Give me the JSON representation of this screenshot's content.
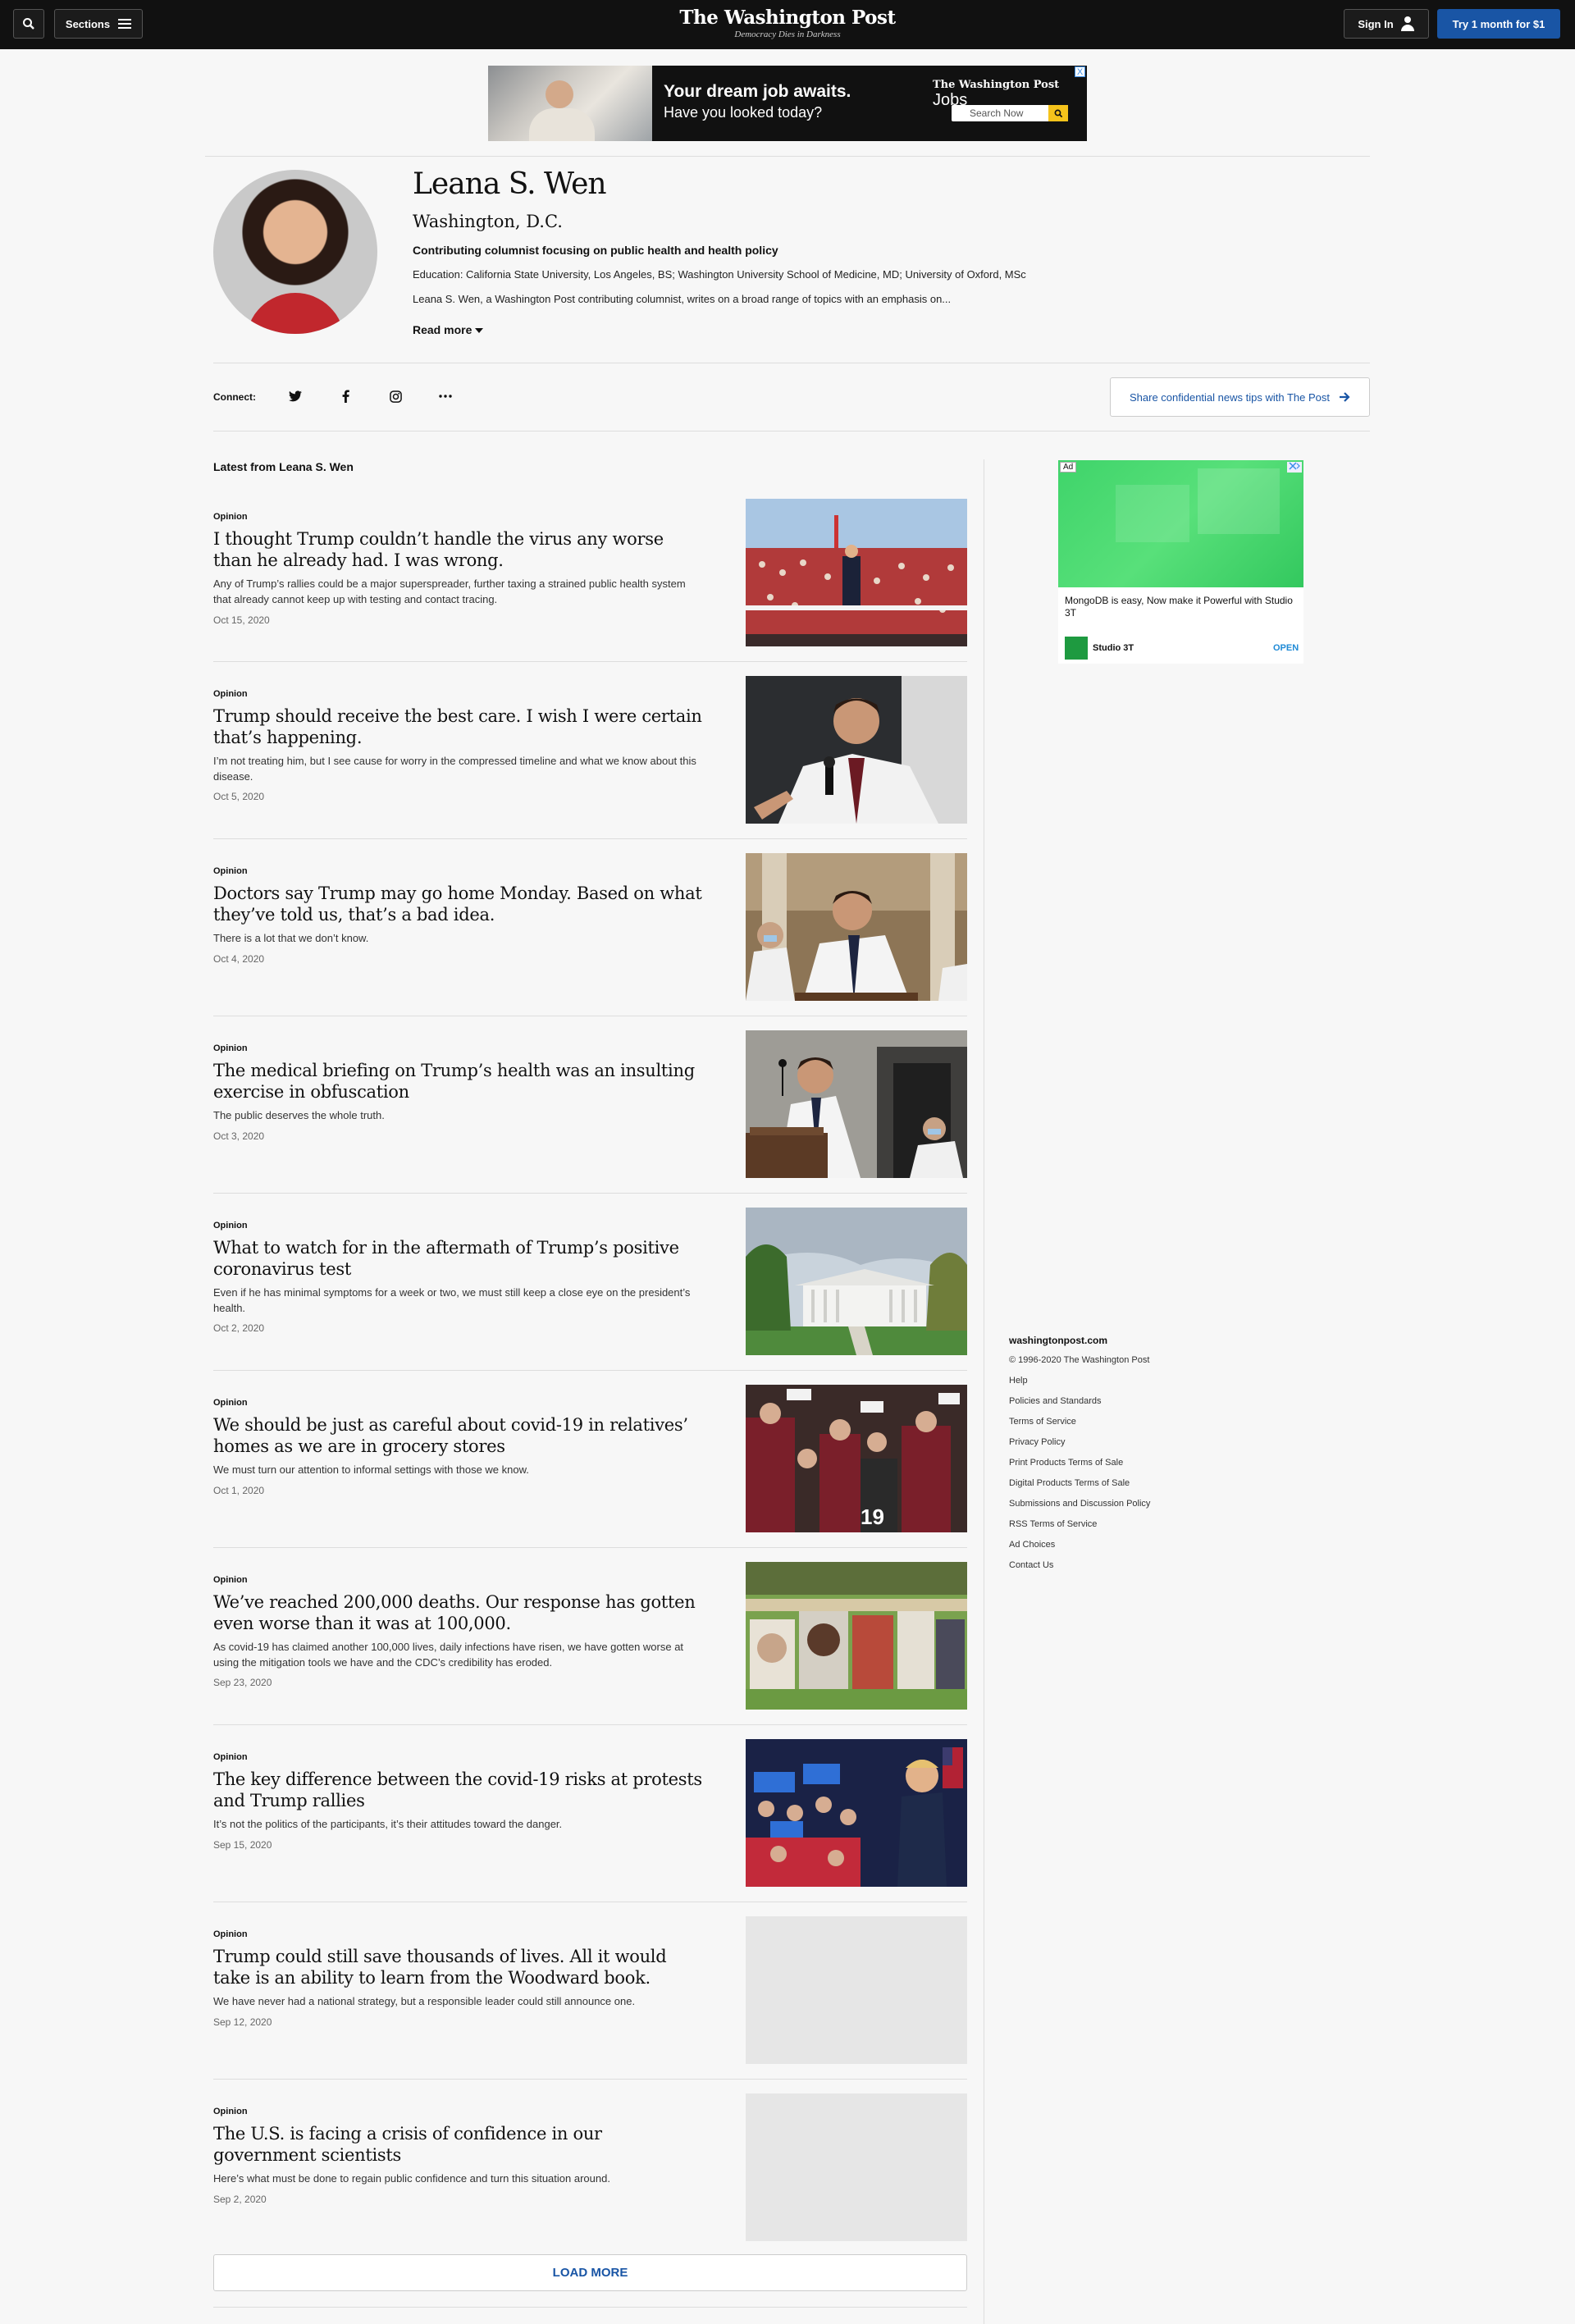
{
  "header": {
    "sections_label": "Sections",
    "logo": "The Washington Post",
    "tagline": "Democracy Dies in Darkness",
    "signin_label": "Sign In",
    "subscribe_label": "Try 1 month for $1"
  },
  "top_ad": {
    "headline": "Your dream job awaits.",
    "subline": "Have you looked today?",
    "brand": "The Washington Post",
    "brand_suffix": "Jobs",
    "search_label": "Search Now",
    "close": "X"
  },
  "author": {
    "name": "Leana S. Wen",
    "location": "Washington, D.C.",
    "role": "Contributing columnist focusing on public health and health policy",
    "education": "Education: California State University, Los Angeles, BS; Washington University School of Medicine, MD; University of Oxford, MSc",
    "bio": "Leana S. Wen, a Washington Post contributing columnist, writes on a broad range of topics with an emphasis on...",
    "read_more": "Read more"
  },
  "connect": {
    "label": "Connect:",
    "tips_label": "Share confidential news tips with The Post"
  },
  "feed": {
    "label": "Latest from Leana S. Wen",
    "load_more": "LOAD MORE",
    "articles": [
      {
        "kicker": "Opinion",
        "headline": "I thought Trump couldn’t handle the virus any worse than he already had. I was wrong.",
        "blurb": "Any of Trump’s rallies could be a major superspreader, further taxing a strained public health system that already cannot keep up with testing and contact tracing.",
        "date": "Oct 15, 2020"
      },
      {
        "kicker": "Opinion",
        "headline": "Trump should receive the best care. I wish I were certain that’s happening.",
        "blurb": "I’m not treating him, but I see cause for worry in the compressed timeline and what we know about this disease.",
        "date": "Oct 5, 2020"
      },
      {
        "kicker": "Opinion",
        "headline": "Doctors say Trump may go home Monday. Based on what they’ve told us, that’s a bad idea.",
        "blurb": "There is a lot that we don’t know.",
        "date": "Oct 4, 2020"
      },
      {
        "kicker": "Opinion",
        "headline": "The medical briefing on Trump’s health was an insulting exercise in obfuscation",
        "blurb": "The public deserves the whole truth.",
        "date": "Oct 3, 2020"
      },
      {
        "kicker": "Opinion",
        "headline": "What to watch for in the aftermath of Trump’s positive coronavirus test",
        "blurb": "Even if he has minimal symptoms for a week or two, we must still keep a close eye on the president’s health.",
        "date": "Oct 2, 2020"
      },
      {
        "kicker": "Opinion",
        "headline": "We should be just as careful about covid-19 in relatives’ homes as we are in grocery stores",
        "blurb": "We must turn our attention to informal settings with those we know.",
        "date": "Oct 1, 2020"
      },
      {
        "kicker": "Opinion",
        "headline": "We’ve reached 200,000 deaths. Our response has gotten even worse than it was at 100,000.",
        "blurb": "As covid-19 has claimed another 100,000 lives, daily infections have risen, we have gotten worse at using the mitigation tools we have and the CDC’s credibility has eroded.",
        "date": "Sep 23, 2020"
      },
      {
        "kicker": "Opinion",
        "headline": "The key difference between the covid-19 risks at protests and Trump rallies",
        "blurb": "It’s not the politics of the participants, it’s their attitudes toward the danger.",
        "date": "Sep 15, 2020"
      },
      {
        "kicker": "Opinion",
        "headline": "Trump could still save thousands of lives. All it would take is an ability to learn from the Woodward book.",
        "blurb": "We have never had a national strategy, but a responsible leader could still announce one.",
        "date": "Sep 12, 2020"
      },
      {
        "kicker": "Opinion",
        "headline": "The U.S. is facing a crisis of confidence in our government scientists",
        "blurb": "Here’s what must be done to regain public confidence and turn this situation around.",
        "date": "Sep 2, 2020"
      }
    ]
  },
  "side_ad": {
    "badge": "Ad",
    "text": "MongoDB is easy, Now make it Powerful with Studio 3T",
    "brand": "Studio 3T",
    "cta": "OPEN"
  },
  "footer": {
    "site": "washingtonpost.com",
    "links": [
      "© 1996-2020 The Washington Post",
      "Help",
      "Policies and Standards",
      "Terms of Service",
      "Privacy Policy",
      "Print Products Terms of Sale",
      "Digital Products Terms of Sale",
      "Submissions and Discussion Policy",
      "RSS Terms of Service",
      "Ad Choices",
      "Contact Us"
    ]
  },
  "colors": {
    "header_bg": "#111111",
    "accent_blue": "#1955a5",
    "page_bg": "#f7f7f7"
  }
}
